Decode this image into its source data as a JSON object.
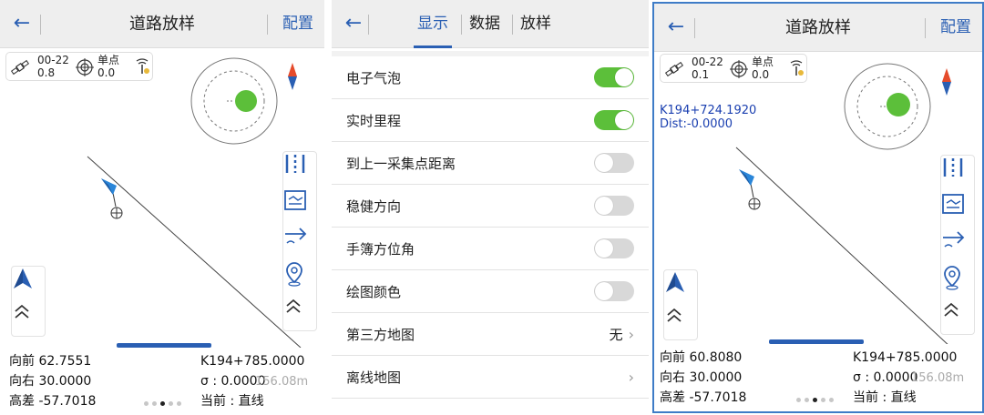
{
  "colors": {
    "accent": "#2a5fb3",
    "toggle_on": "#5cbf3a",
    "toggle_off": "#d8d8d8",
    "target": "#5cbf3a",
    "selection_border": "#3e7cc7"
  },
  "panel1": {
    "title": "道路放样",
    "config_label": "配置",
    "status": {
      "sat_count": "00-22",
      "sat_value": "0.8",
      "mode_label": "单点",
      "mode_value": "0.0"
    },
    "info": {
      "forward": "向前 62.7551",
      "right": "向右 30.0000",
      "height_diff": "高差 -57.7018",
      "station": "K194+785.0000",
      "sigma": "σ : 0.0000",
      "current": "当前 : 直线",
      "scale": "156.08m"
    }
  },
  "panel2": {
    "tabs": [
      {
        "label": "显示"
      },
      {
        "label": "数据"
      },
      {
        "label": "放样"
      }
    ],
    "settings": [
      {
        "label": "电子气泡",
        "state": true
      },
      {
        "label": "实时里程",
        "state": true
      },
      {
        "label": "到上一采集点距离",
        "state": false
      },
      {
        "label": "稳健方向",
        "state": false
      },
      {
        "label": "手簿方位角",
        "state": false
      },
      {
        "label": "绘图颜色",
        "state": false
      },
      {
        "label": "第三方地图",
        "value": "无"
      },
      {
        "label": "离线地图",
        "value": ""
      }
    ]
  },
  "panel3": {
    "title": "道路放样",
    "config_label": "配置",
    "status": {
      "sat_count": "00-22",
      "sat_value": "0.1",
      "mode_label": "单点",
      "mode_value": "0.0"
    },
    "mileage_chip": {
      "station": "K194+724.1920",
      "dist": "Dist:-0.0000"
    },
    "info": {
      "forward": "向前 60.8080",
      "right": "向右 30.0000",
      "height_diff": "高差 -57.7018",
      "station": "K194+785.0000",
      "sigma": "σ : 0.0000",
      "current": "当前 : 直线",
      "scale": "156.08m"
    }
  }
}
